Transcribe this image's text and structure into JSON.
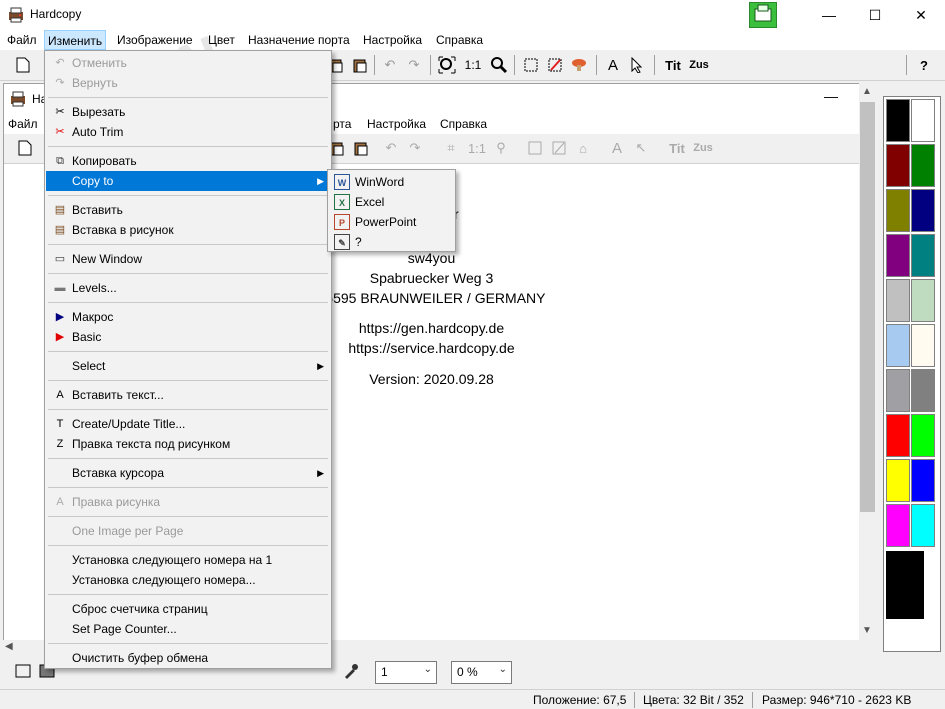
{
  "window": {
    "title": "Hardcopy",
    "minimize": "—",
    "maximize": "☐",
    "close": "✕"
  },
  "menubar": [
    "Файл",
    "Изменить",
    "Изображение",
    "Цвет",
    "Назначение порта",
    "Настройка",
    "Справка"
  ],
  "inner_window": {
    "title": "Ha",
    "menubar": [
      "Файл",
      "Настройка",
      "Справка"
    ],
    "menubar_partial": "рта",
    "info_lines": [
      "sw4you",
      "Spabruecker Weg 3",
      "55595 BRAUNWEILER / GERMANY",
      "https://gen.hardcopy.de",
      "https://service.hardcopy.de",
      "Version: 2020.09.28"
    ],
    "partial_top_text": "r"
  },
  "toolbar": {
    "zoom_1_1": "1:1",
    "tit": "Tit",
    "zus": "Zus",
    "help": "?",
    "text_a": "A"
  },
  "edit_menu": [
    {
      "label": "Отменить",
      "disabled": true,
      "icon": "undo-icon"
    },
    {
      "label": "Вернуть",
      "disabled": true,
      "icon": "redo-icon"
    },
    {
      "label": "Вырезать",
      "disabled": false,
      "icon": "scissors-icon"
    },
    {
      "label": "Auto Trim",
      "disabled": false,
      "icon": "auto-trim-icon"
    },
    {
      "label": "Копировать",
      "disabled": false,
      "icon": "copy-icon"
    },
    {
      "label": "Copy to",
      "disabled": false,
      "icon": "",
      "submenu": true,
      "highlighted": true
    },
    {
      "label": "Вставить",
      "disabled": false,
      "icon": "paste-icon"
    },
    {
      "label": "Вставка в рисунок",
      "disabled": false,
      "icon": "paste-into-image-icon"
    },
    {
      "label": "New Window",
      "disabled": false,
      "icon": "new-window-icon"
    },
    {
      "label": "Levels...",
      "disabled": false,
      "icon": "levels-icon"
    },
    {
      "label": "Макрос",
      "disabled": false,
      "icon": "macro-play-icon"
    },
    {
      "label": "Basic",
      "disabled": false,
      "icon": "basic-play-icon"
    },
    {
      "label": "Select",
      "disabled": false,
      "icon": "",
      "submenu": true
    },
    {
      "label": "Вставить текст...",
      "disabled": false,
      "icon": "text-icon"
    },
    {
      "label": "Create/Update Title...",
      "disabled": false,
      "icon": "title-icon"
    },
    {
      "label": "Правка текста под рисунком",
      "disabled": false,
      "icon": "caption-icon"
    },
    {
      "label": "Вставка курсора",
      "disabled": false,
      "icon": "",
      "submenu": true
    },
    {
      "label": "Правка рисунка",
      "disabled": true,
      "icon": "edit-image-icon"
    },
    {
      "label": "One Image per Page",
      "disabled": true,
      "icon": ""
    },
    {
      "label": "Установка следующего номера на 1",
      "disabled": false,
      "icon": ""
    },
    {
      "label": "Установка следующего номера...",
      "disabled": false,
      "icon": ""
    },
    {
      "label": "Сброс счетчика страниц",
      "disabled": false,
      "icon": ""
    },
    {
      "label": "Set Page Counter...",
      "disabled": false,
      "icon": ""
    },
    {
      "label": "Очистить буфер обмена",
      "disabled": false,
      "icon": ""
    }
  ],
  "copy_to_submenu": [
    {
      "label": "WinWord",
      "icon": "word-icon",
      "glyph": "W",
      "color": "#2b579a"
    },
    {
      "label": "Excel",
      "icon": "excel-icon",
      "glyph": "X",
      "color": "#217346"
    },
    {
      "label": "PowerPoint",
      "icon": "powerpoint-icon",
      "glyph": "P",
      "color": "#b7472a"
    },
    {
      "label": "?",
      "icon": "custom-app-icon",
      "glyph": "✎",
      "color": "#444444"
    }
  ],
  "palette": [
    "#000000",
    "#ffffff",
    "#800000",
    "#008000",
    "#808000",
    "#000080",
    "#800080",
    "#008080",
    "#c0c0c0",
    "#c0dcc0",
    "#a6caf0",
    "#fffbf0",
    "#a0a0a4",
    "#808080",
    "#ff0000",
    "#00ff00",
    "#ffff00",
    "#0000ff",
    "#ff00ff",
    "#00ffff"
  ],
  "bottom": {
    "width_value": "1",
    "percent_value": "0 %"
  },
  "status": {
    "position": "Положение: 67,5",
    "colors": "Цвета: 32 Bit / 352",
    "size": "Размер: 946*710  -  2623 KB"
  }
}
